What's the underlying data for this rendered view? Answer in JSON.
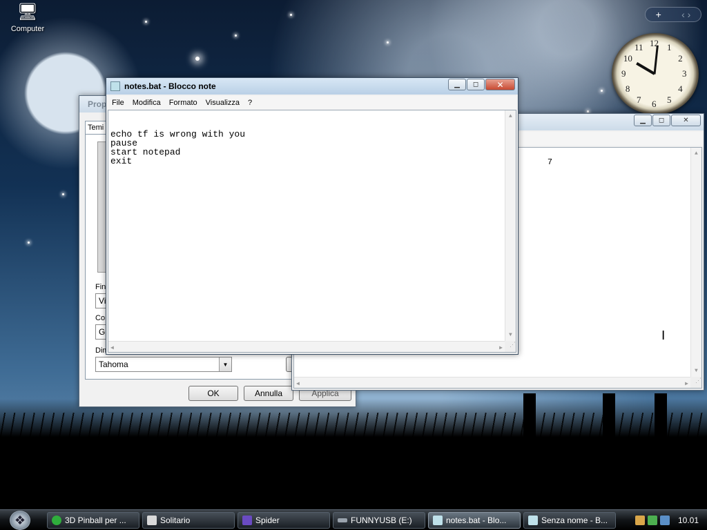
{
  "desktop": {
    "icons": [
      {
        "label": "Computer",
        "icon": "computer-icon"
      }
    ]
  },
  "sidebar": {
    "add_label": "+",
    "nav_label": "‹ ›",
    "clock": {
      "hour": 10,
      "minute": 1,
      "numbers": [
        "12",
        "1",
        "2",
        "3",
        "4",
        "5",
        "6",
        "7",
        "8",
        "9",
        "10",
        "11"
      ]
    }
  },
  "properties_window": {
    "title": "Propr",
    "tab_label": "Temi",
    "labels": {
      "finestra": "Fine",
      "colore": "Co",
      "dimensione": "Dim"
    },
    "finestra_value": "Vis",
    "colore_value": "Gla",
    "font_value": "Tahoma",
    "buttons": {
      "ok": "OK",
      "cancel": "Annulla",
      "apply": "Applica"
    }
  },
  "back_notepad": {
    "text": "7"
  },
  "notepad": {
    "title": "notes.bat - Blocco note",
    "menu": [
      "File",
      "Modifica",
      "Formato",
      "Visualizza",
      "?"
    ],
    "content": "echo tf is wrong with you\npause\nstart notepad\nexit"
  },
  "taskbar": {
    "items": [
      {
        "label": "3D Pinball per ...",
        "color": "#2fae3c"
      },
      {
        "label": "Solitario",
        "color": "#d9d9d9"
      },
      {
        "label": "Spider",
        "color": "#6a4bc2"
      },
      {
        "label": "FUNNYUSB (E:)",
        "color": "#9aa3ad"
      },
      {
        "label": "notes.bat - Blo...",
        "color": "#bfe1ea"
      },
      {
        "label": "Senza nome - B...",
        "color": "#bfe1ea"
      }
    ],
    "time": "10.01"
  },
  "colors": {
    "accent": "#b9d0e6",
    "close": "#c84a32"
  }
}
